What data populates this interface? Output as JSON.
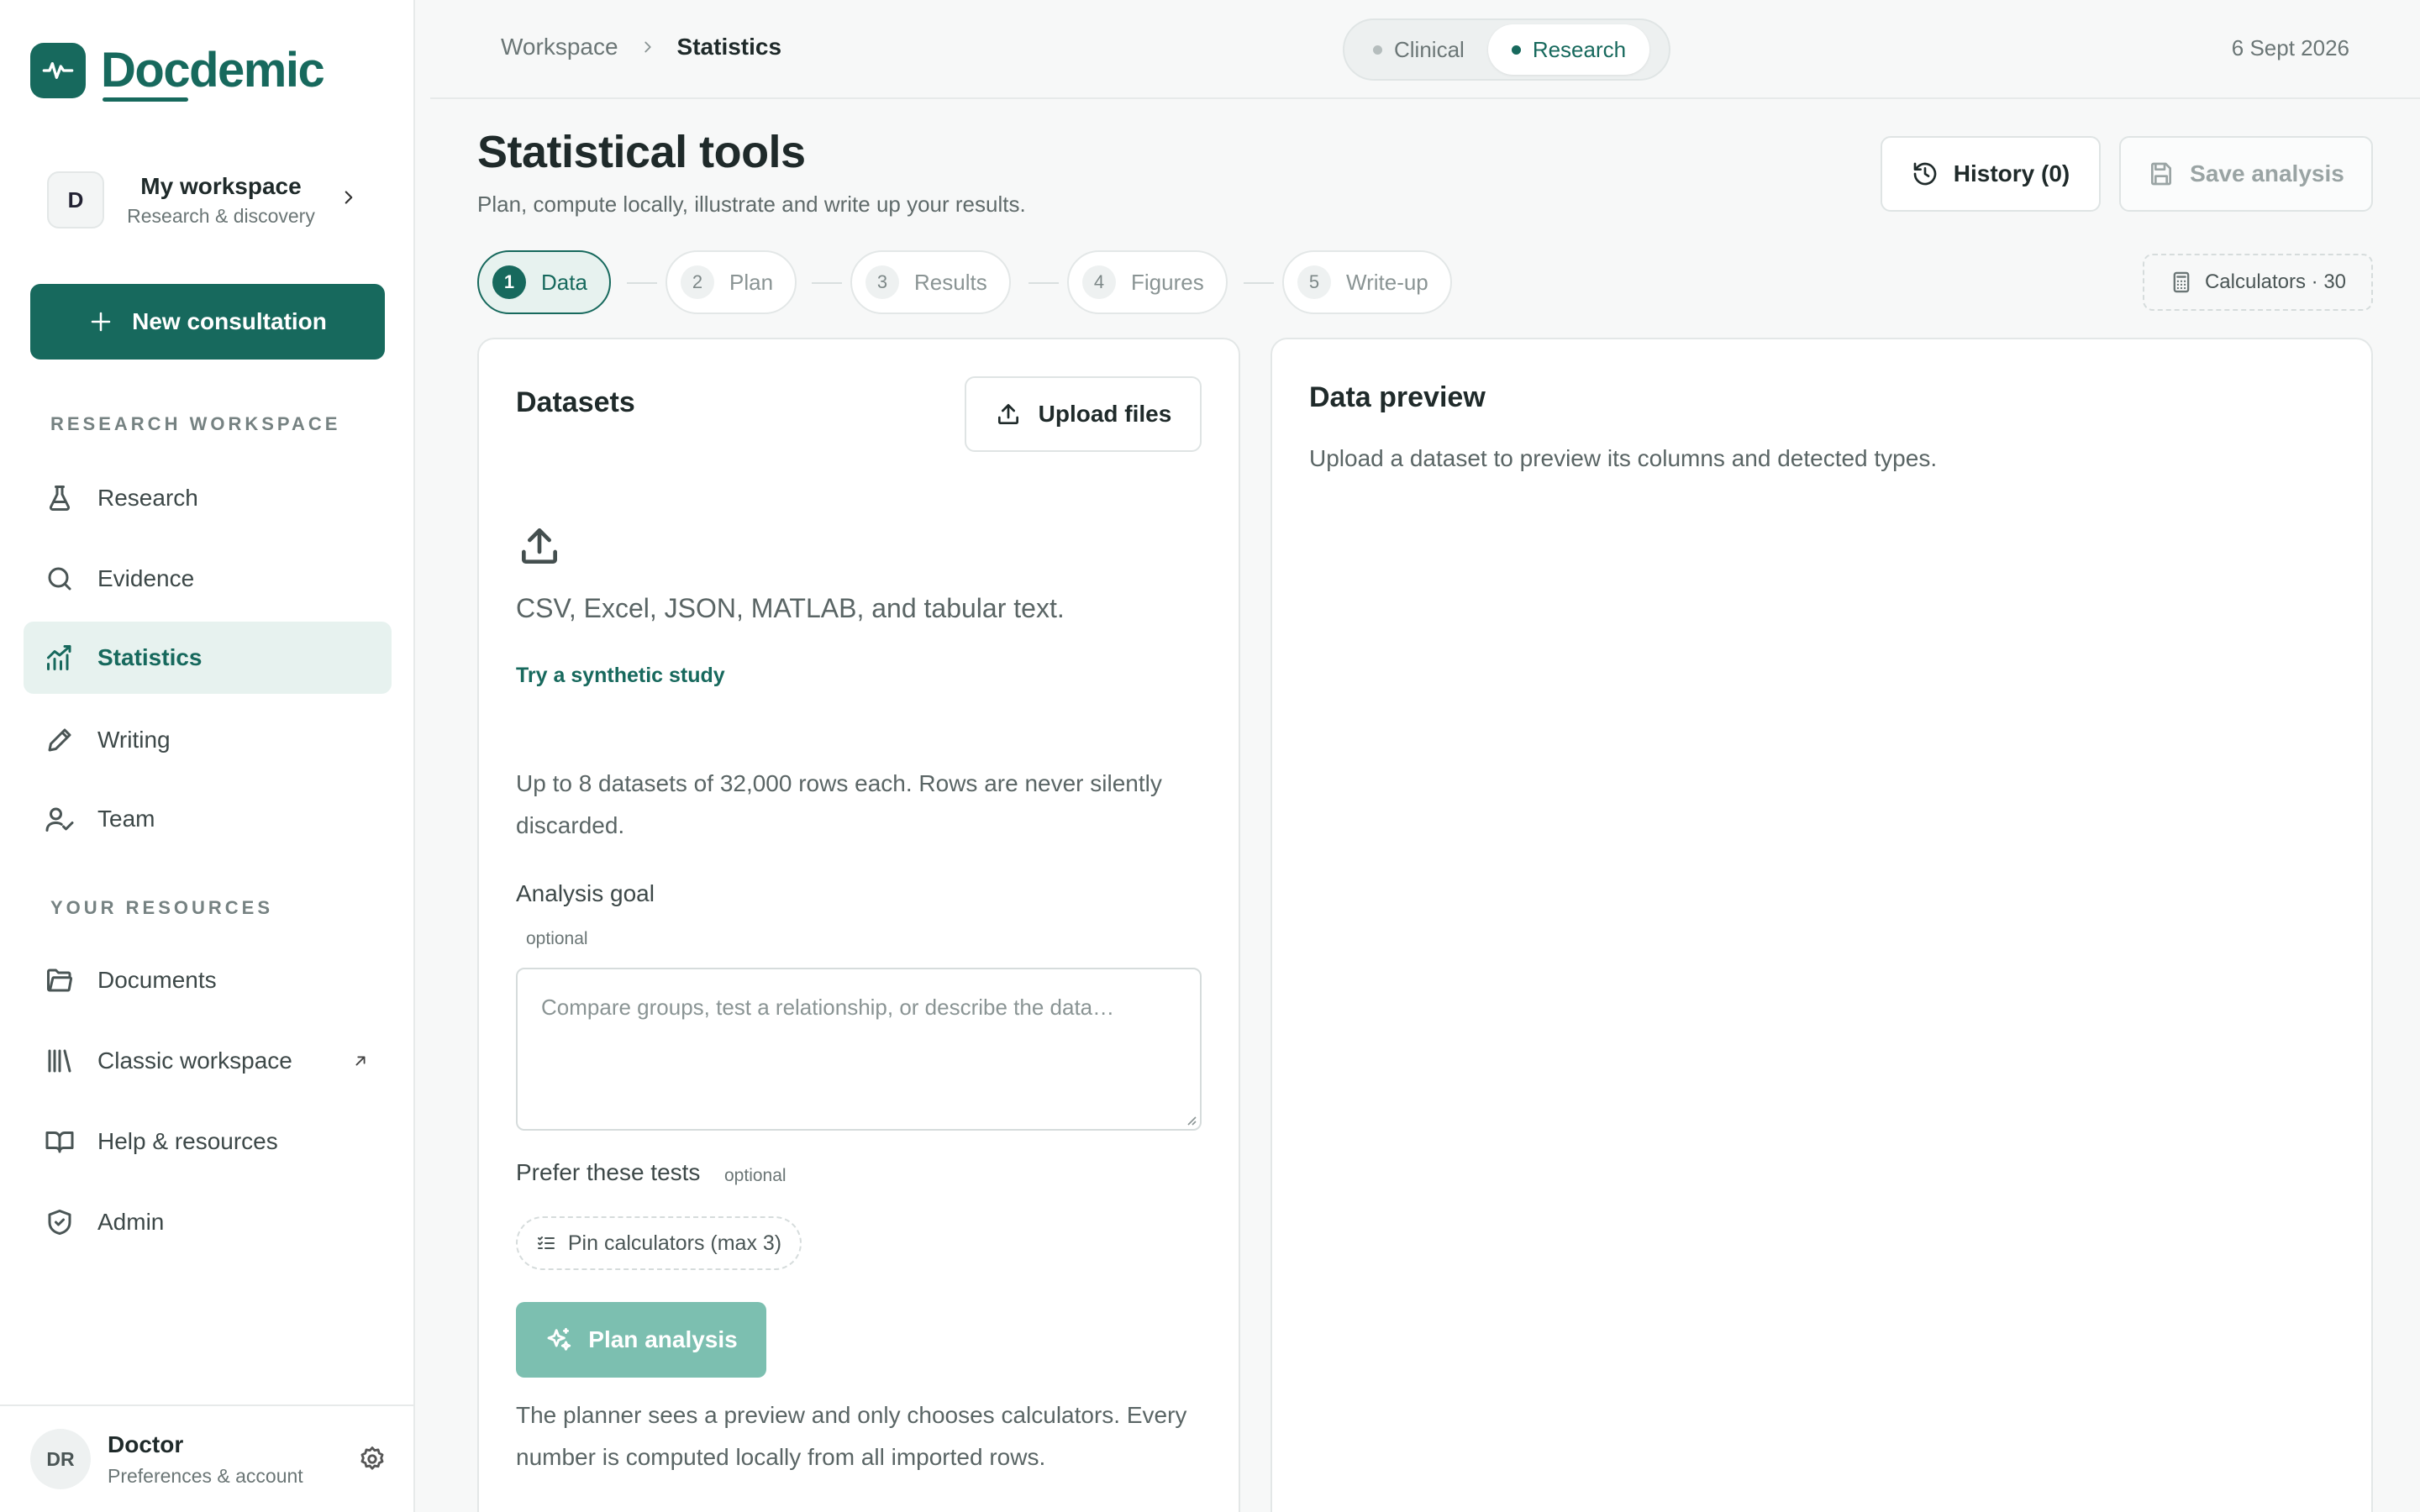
{
  "brand": {
    "name": "Docdemic"
  },
  "workspace": {
    "avatar_letter": "D",
    "name": "My workspace",
    "subtitle": "Research & discovery"
  },
  "sidebar": {
    "new_consultation": "New consultation",
    "section_research": "RESEARCH WORKSPACE",
    "research_items": [
      {
        "label": "Research",
        "icon": "flask-icon"
      },
      {
        "label": "Evidence",
        "icon": "search-icon"
      },
      {
        "label": "Statistics",
        "icon": "chart-icon",
        "active": true
      },
      {
        "label": "Writing",
        "icon": "pen-icon"
      },
      {
        "label": "Team",
        "icon": "user-check-icon"
      }
    ],
    "section_resources": "YOUR RESOURCES",
    "resource_items": [
      {
        "label": "Documents",
        "icon": "folder-icon"
      },
      {
        "label": "Classic workspace",
        "icon": "library-icon",
        "external": true
      },
      {
        "label": "Help & resources",
        "icon": "book-icon"
      },
      {
        "label": "Admin",
        "icon": "shield-icon"
      }
    ]
  },
  "user": {
    "initials": "DR",
    "name": "Doctor",
    "subtitle": "Preferences & account"
  },
  "topbar": {
    "breadcrumb": [
      "Workspace",
      "Statistics"
    ],
    "modes": [
      "Clinical",
      "Research"
    ],
    "active_mode": "Research",
    "date": "6 Sept 2026"
  },
  "page": {
    "title": "Statistical tools",
    "subtitle": "Plan, compute locally, illustrate and write up your results.",
    "history_label": "History (0)",
    "save_label": "Save analysis",
    "calculators_label": "Calculators · 30"
  },
  "steps": [
    {
      "num": "1",
      "label": "Data",
      "active": true
    },
    {
      "num": "2",
      "label": "Plan"
    },
    {
      "num": "3",
      "label": "Results"
    },
    {
      "num": "4",
      "label": "Figures"
    },
    {
      "num": "5",
      "label": "Write-up"
    }
  ],
  "datasets": {
    "title": "Datasets",
    "upload_label": "Upload files",
    "formats": "CSV, Excel, JSON, MATLAB, and tabular text.",
    "try_link": "Try a synthetic study",
    "limits": "Up to 8 datasets of 32,000 rows each. Rows are never silently discarded.",
    "goal_label": "Analysis goal",
    "goal_optional": "optional",
    "goal_placeholder": "Compare groups, test a relationship, or describe the data…",
    "tests_label": "Prefer these tests",
    "tests_optional": "optional",
    "pin_label": "Pin calculators (max 3)",
    "plan_label": "Plan analysis",
    "planner_note": "The planner sees a preview and only chooses calculators. Every number is computed locally from all imported rows."
  },
  "preview": {
    "title": "Data preview",
    "empty_text": "Upload a dataset to preview its columns and detected types."
  },
  "colors": {
    "accent": "#17695d",
    "accent_light": "#e7f2ef",
    "disabled_accent": "#7cbfb0"
  }
}
